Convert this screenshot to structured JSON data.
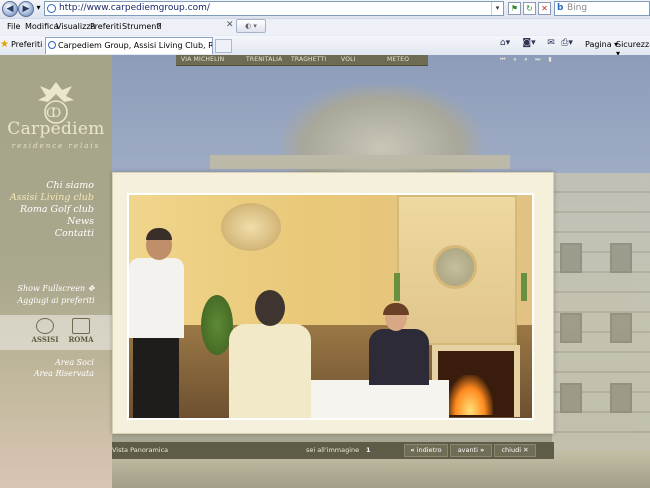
{
  "browser": {
    "address": "http://www.carpediemgroup.com/",
    "search_placeholder": "Bing",
    "menu": [
      "File",
      "Modifica",
      "Visualizza",
      "Preferiti",
      "Strumenti",
      "?"
    ],
    "favorites_label": "Preferiti",
    "tab_title": "Carpediem Group, Assisi Living Club, Roma Golf Club, ...",
    "command_bar": {
      "page": "Pagina",
      "security": "Sicurezza"
    }
  },
  "site": {
    "topnav": [
      "VIA MICHELIN",
      "TRENITALIA",
      "TRAGHETTI",
      "VOLI",
      "METEO"
    ],
    "brand": {
      "name": "Carpediem",
      "tagline": "residence relais"
    },
    "menu": [
      "Chi siamo",
      "Assisi Living club",
      "Roma Golf club",
      "News",
      "Contatti"
    ],
    "tools": [
      "Show Fullscreen",
      "Aggiugi ai preferiti"
    ],
    "partners": [
      "ASSISI",
      "ROMA"
    ],
    "member_links": [
      "Area Soci",
      "Area Riservata"
    ],
    "gallery": {
      "caption": "Vista Panoramica",
      "counter_label": "sei all'immagine",
      "counter_value": "1",
      "back": "indietro",
      "next": "avanti",
      "close": "chiudi"
    }
  }
}
